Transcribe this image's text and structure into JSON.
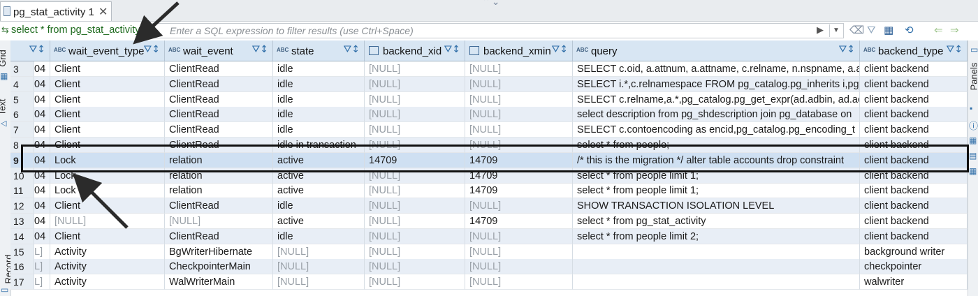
{
  "tab": {
    "label": "pg_stat_activity 1",
    "close": "✕"
  },
  "filter": {
    "sql": "select * from pg_stat_activity",
    "placeholder": "Enter a SQL expression to filter results (use Ctrl+Space)"
  },
  "side": {
    "grid": "Grid",
    "text": "Text",
    "record": "Record",
    "panels": "Panels"
  },
  "columns": [
    {
      "label": "wait_event_type",
      "type": "ABC"
    },
    {
      "label": "wait_event",
      "type": "ABC"
    },
    {
      "label": "state",
      "type": "ABC"
    },
    {
      "label": "backend_xid",
      "type": "box"
    },
    {
      "label": "backend_xmin",
      "type": "box"
    },
    {
      "label": "query",
      "type": "ABC"
    },
    {
      "label": "backend_type",
      "type": "ABC"
    }
  ],
  "rows": [
    {
      "n": "3",
      "p": "04",
      "c": [
        "Client",
        "ClientRead",
        "idle",
        "[NULL]",
        "[NULL]",
        "SELECT c.oid, a.attnum, a.attname, c.relname, n.nspname, a.a",
        "client backend"
      ]
    },
    {
      "n": "4",
      "p": "04",
      "c": [
        "Client",
        "ClientRead",
        "idle",
        "[NULL]",
        "[NULL]",
        "SELECT i.*,c.relnamespace FROM pg_catalog.pg_inherits i,pg_",
        "client backend"
      ]
    },
    {
      "n": "5",
      "p": "04",
      "c": [
        "Client",
        "ClientRead",
        "idle",
        "[NULL]",
        "[NULL]",
        "SELECT c.relname,a.*,pg_catalog.pg_get_expr(ad.adbin, ad.ac",
        "client backend"
      ]
    },
    {
      "n": "6",
      "p": "04",
      "c": [
        "Client",
        "ClientRead",
        "idle",
        "[NULL]",
        "[NULL]",
        "select description from pg_shdescription join pg_database on",
        "client backend"
      ]
    },
    {
      "n": "7",
      "p": "04",
      "c": [
        "Client",
        "ClientRead",
        "idle",
        "[NULL]",
        "[NULL]",
        "SELECT c.contoencoding as encid,pg_catalog.pg_encoding_t",
        "client backend"
      ]
    },
    {
      "n": "8",
      "p": "04",
      "c": [
        "Client",
        "ClientRead",
        "idle in transaction",
        "[NULL]",
        "[NULL]",
        "select * from people;",
        "client backend"
      ]
    },
    {
      "n": "9",
      "p": "04",
      "c": [
        "Lock",
        "relation",
        "active",
        "14709",
        "14709",
        "/* this is the migration */ alter table accounts drop constraint",
        "client backend"
      ]
    },
    {
      "n": "10",
      "p": "04",
      "c": [
        "Lock",
        "relation",
        "active",
        "[NULL]",
        "14709",
        "select * from people limit 1;",
        "client backend"
      ]
    },
    {
      "n": "11",
      "p": "04",
      "c": [
        "Lock",
        "relation",
        "active",
        "[NULL]",
        "14709",
        "select * from people limit 1;",
        "client backend"
      ]
    },
    {
      "n": "12",
      "p": "04",
      "c": [
        "Client",
        "ClientRead",
        "idle",
        "[NULL]",
        "[NULL]",
        "SHOW TRANSACTION ISOLATION LEVEL",
        "client backend"
      ]
    },
    {
      "n": "13",
      "p": "04",
      "c": [
        "[NULL]",
        "[NULL]",
        "active",
        "[NULL]",
        "14709",
        "select * from pg_stat_activity",
        "client backend"
      ]
    },
    {
      "n": "14",
      "p": "04",
      "c": [
        "Client",
        "ClientRead",
        "idle",
        "[NULL]",
        "[NULL]",
        "select * from people limit 2;",
        "client backend"
      ]
    },
    {
      "n": "15",
      "p": "L]",
      "c": [
        "Activity",
        "BgWriterHibernate",
        "[NULL]",
        "[NULL]",
        "[NULL]",
        "",
        "background writer"
      ]
    },
    {
      "n": "16",
      "p": "L]",
      "c": [
        "Activity",
        "CheckpointerMain",
        "[NULL]",
        "[NULL]",
        "[NULL]",
        "",
        "checkpointer"
      ]
    },
    {
      "n": "17",
      "p": "L]",
      "c": [
        "Activity",
        "WalWriterMain",
        "[NULL]",
        "[NULL]",
        "[NULL]",
        "",
        "walwriter"
      ]
    }
  ],
  "selected_row": "9",
  "colors": {
    "header": "#d8e6f3",
    "selection": "#cfe0f2",
    "alt_row": "#e8eef6",
    "sql_text": "#1e6b1e",
    "null_text": "#9aa1a8"
  }
}
